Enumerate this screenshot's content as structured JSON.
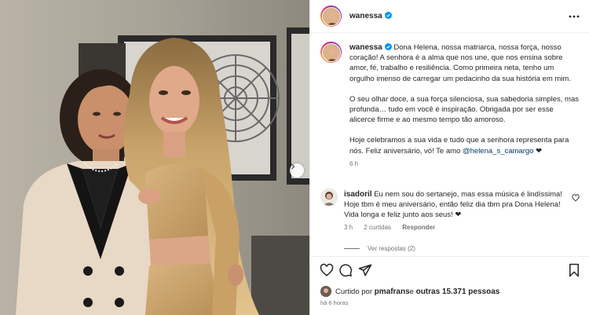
{
  "post": {
    "username": "wanessa",
    "caption": {
      "p1": "Dona Helena, nossa matriarca, nossa força, nosso coração! A senhora é a alma que nos une, que nos ensina sobre amor, fé, trabalho e resiliência. Como primeira neta, tenho um orgulho imenso de carregar um pedacinho da sua história em mim.",
      "p2": "O seu olhar doce, a sua força silenciosa, sua sabedoria simples, mas profunda… tudo em você é inspiração. Obrigada por ser esse alicerce firme e ao mesmo tempo tão amoroso.",
      "p3_text": "Hoje celebramos a sua vida e tudo que a senhora representa para nós. Feliz aniversário, vó! Te amo ",
      "p3_mention": "@helena_s_camargo",
      "p3_heart": " ❤",
      "age": "6 h"
    }
  },
  "comment": {
    "username": "isadoril",
    "text": "Eu nem sou do sertanejo, mas essa música é lindíssima! Hoje tbm é meu aniversário, então feliz dia tbm pra Dona Helena! Vida longa e feliz junto aos seus! ❤",
    "age": "3 h",
    "likes": "2 curtidas",
    "reply": "Responder",
    "view_replies": "Ver respostas (2)"
  },
  "likes": {
    "prefix": "Curtido por ",
    "user": "pmafrans",
    "middle": " e ",
    "others": "outras 15.371 pessoas"
  },
  "time_ago": "há 6 horas",
  "colors": {
    "verified": "#0095f6",
    "link": "#00376b",
    "muted": "#737373"
  }
}
